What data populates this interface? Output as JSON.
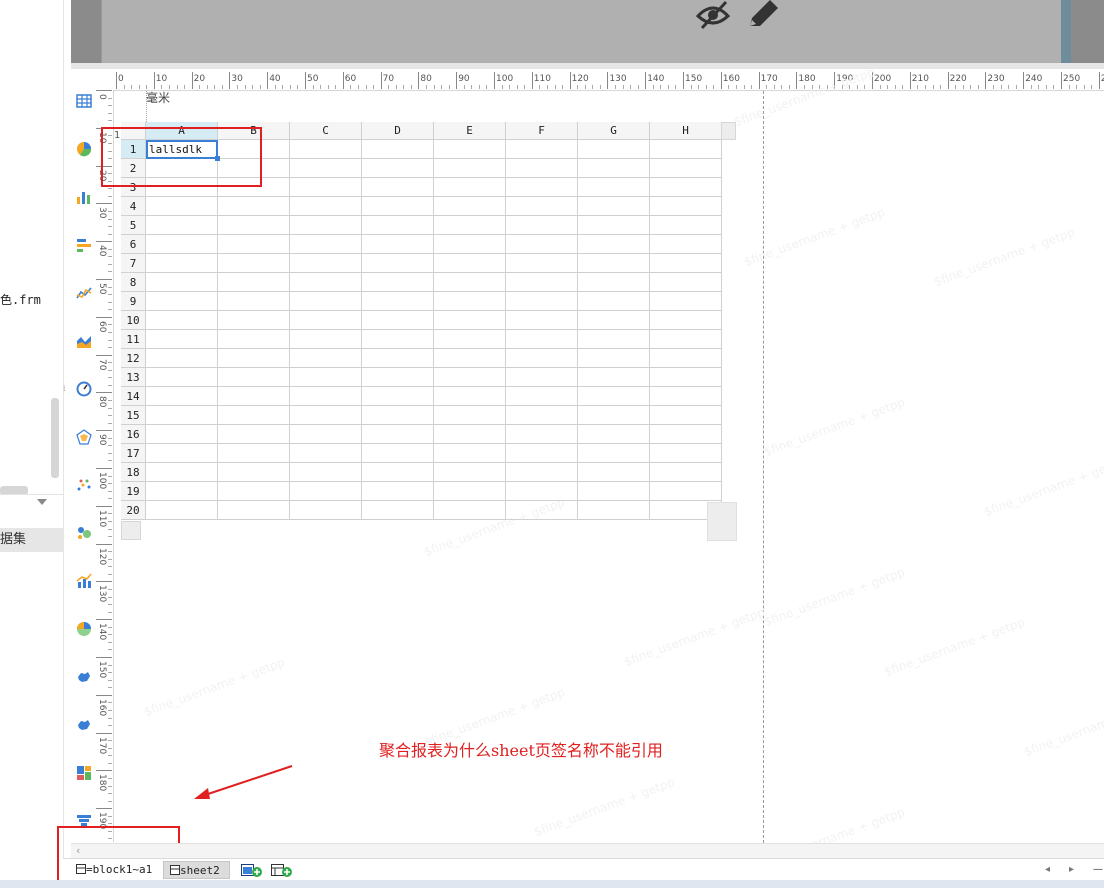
{
  "left_panel": {
    "file_label": "色.frm",
    "section_label": "据集"
  },
  "canvas": {
    "unit_label": "毫米",
    "top_ruler_ticks": [
      "0",
      "10",
      "20",
      "30",
      "40",
      "50",
      "60",
      "70",
      "80",
      "90",
      "100",
      "110",
      "120",
      "130",
      "140",
      "150",
      "160",
      "170",
      "180",
      "190",
      "200",
      "210",
      "220",
      "230",
      "240",
      "250",
      "26"
    ],
    "left_ruler_ticks": [
      "0",
      "10",
      "20",
      "30",
      "40",
      "50",
      "60",
      "70",
      "80",
      "90",
      "100",
      "110",
      "120",
      "130",
      "140",
      "150",
      "160",
      "170",
      "180",
      "190"
    ]
  },
  "sheet": {
    "columns": [
      "A",
      "B",
      "C",
      "D",
      "E",
      "F",
      "G",
      "H"
    ],
    "rows": [
      "1",
      "2",
      "3",
      "4",
      "5",
      "6",
      "7",
      "8",
      "9",
      "10",
      "11",
      "12",
      "13",
      "14",
      "15",
      "16",
      "17",
      "18",
      "19",
      "20"
    ],
    "cell_a1": "lallsdlk",
    "corner_label": "1"
  },
  "annotation": {
    "question": "聚合报表为什么sheet页签名称不能引用",
    "color": "#e02020"
  },
  "tabs": [
    {
      "label": "=block1~a1"
    },
    {
      "label": "sheet2"
    }
  ],
  "watermark": "$fine_username + getpp",
  "icons": {
    "component_bar": [
      "table-icon",
      "pie-chart-icon",
      "bar-chart-icon",
      "horizontal-bar-icon",
      "line-chart-icon",
      "area-chart-icon",
      "gauge-icon",
      "radar-icon",
      "scatter-icon",
      "bubble-icon",
      "combo-chart-icon",
      "rose-chart-icon",
      "map-icon",
      "map-icon-2",
      "treemap-icon",
      "funnel-icon"
    ],
    "preview": [
      "hidden-eye-icon",
      "pencil-icon"
    ]
  }
}
